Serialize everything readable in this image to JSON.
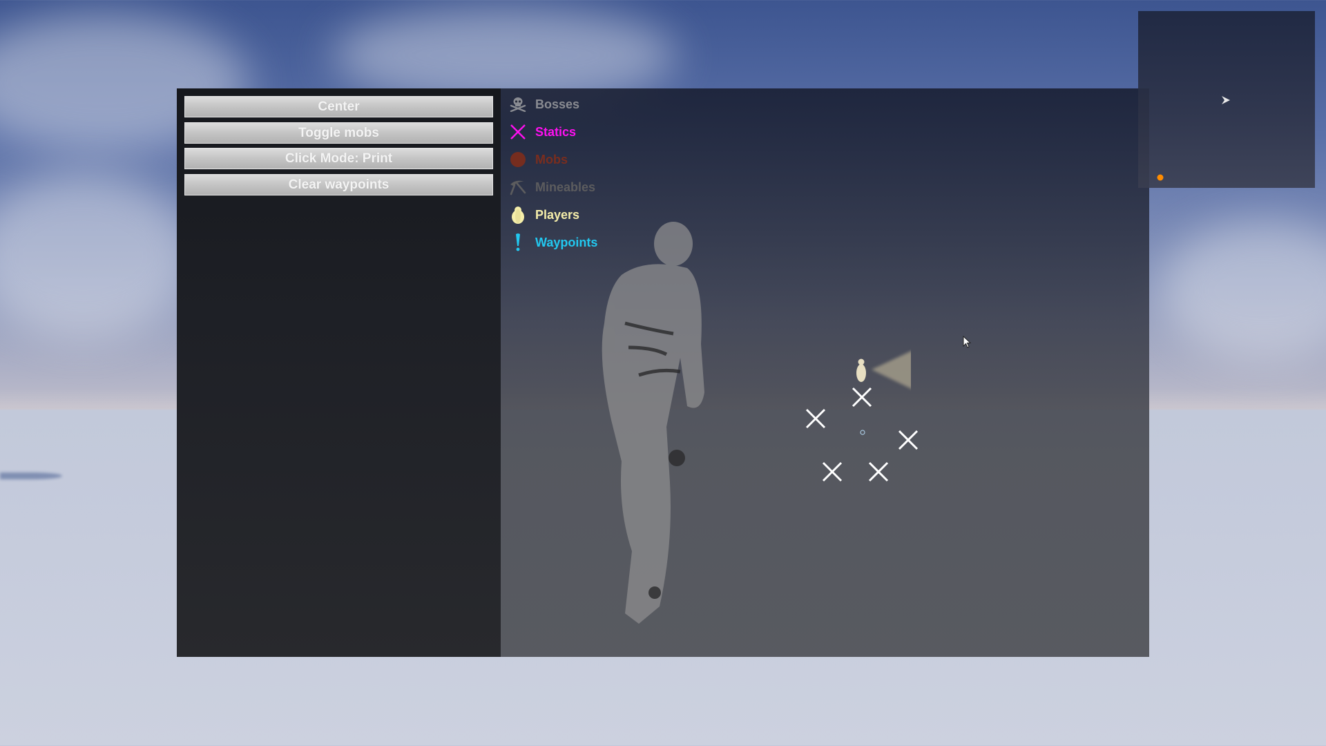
{
  "buttons": {
    "center": "Center",
    "toggle_mobs": "Toggle mobs",
    "click_mode": "Click Mode: Print",
    "clear_waypoints": "Clear waypoints"
  },
  "legend": [
    {
      "label": "Bosses",
      "icon": "skull-crossbones-icon",
      "color": "#8a8c92"
    },
    {
      "label": "Statics",
      "icon": "x-mark-icon",
      "color": "#ff10f0"
    },
    {
      "label": "Mobs",
      "icon": "red-circle-icon",
      "color": "#7a2d1e"
    },
    {
      "label": "Mineables",
      "icon": "pickaxe-icon",
      "color": "#5c5c5e"
    },
    {
      "label": "Players",
      "icon": "pawn-icon",
      "color": "#f5eeaa"
    },
    {
      "label": "Waypoints",
      "icon": "exclamation-icon",
      "color": "#22c8f0"
    }
  ],
  "map": {
    "player_color": "#e8dfc2",
    "static_marker_count": 5,
    "static_marker_color": "#ffffff",
    "waypoint_color": "#a8c8e0"
  },
  "minimap": {
    "player_arrow_color": "#e8e8e8",
    "dot_color": "#ff8c00"
  }
}
